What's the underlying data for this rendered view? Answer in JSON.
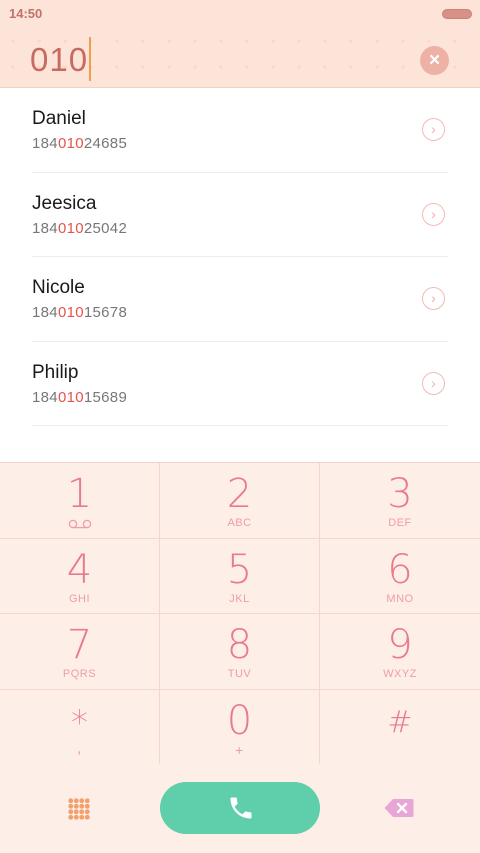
{
  "status_bar": {
    "time": "14:50"
  },
  "dialer": {
    "input": "010",
    "clear_icon": "clear-icon"
  },
  "contacts": [
    {
      "name": "Daniel",
      "pre": "184",
      "match": "010",
      "post": "24685"
    },
    {
      "name": "Jeesica",
      "pre": "184",
      "match": "010",
      "post": "25042"
    },
    {
      "name": "Nicole",
      "pre": "184",
      "match": "010",
      "post": "15678"
    },
    {
      "name": "Philip",
      "pre": "184",
      "match": "010",
      "post": "15689"
    }
  ],
  "keypad": {
    "keys": [
      {
        "digit": "1",
        "letters": ""
      },
      {
        "digit": "2",
        "letters": "ABC"
      },
      {
        "digit": "3",
        "letters": "DEF"
      },
      {
        "digit": "4",
        "letters": "GHI"
      },
      {
        "digit": "5",
        "letters": "JKL"
      },
      {
        "digit": "6",
        "letters": "MNO"
      },
      {
        "digit": "7",
        "letters": "PQRS"
      },
      {
        "digit": "8",
        "letters": "TUV"
      },
      {
        "digit": "9",
        "letters": "WXYZ"
      },
      {
        "digit": "*",
        "letters": ","
      },
      {
        "digit": "0",
        "letters": "+"
      },
      {
        "digit": "#",
        "letters": ""
      }
    ]
  },
  "colors": {
    "accent": "#e97a8a",
    "call": "#5fcfab",
    "highlight": "#e5534d"
  }
}
